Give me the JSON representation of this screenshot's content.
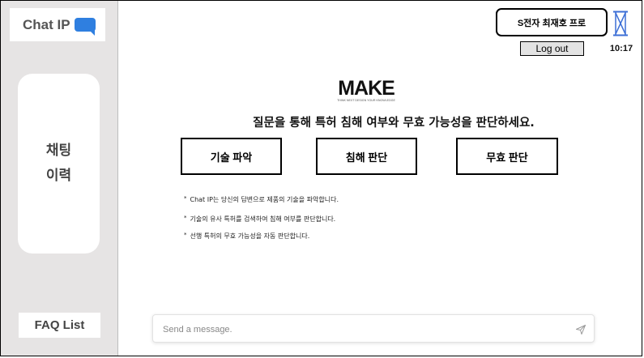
{
  "sidebar": {
    "logo_text": "Chat IP",
    "history_label": "채팅\n이력",
    "faq_label": "FAQ List"
  },
  "header": {
    "user_label": "S전자 최재호 프로",
    "logout_label": "Log out",
    "clock": "10:17"
  },
  "main": {
    "brand_text": "MAKE",
    "brand_subtext": "THINK NEXT DESIGN YOUR KNOWLEDGE",
    "tagline": "질문을 통해 특허 침해 여부와 무효 가능성을 판단하세요.",
    "actions": [
      {
        "label": "기술 파악"
      },
      {
        "label": "침해 판단"
      },
      {
        "label": "무효 판단"
      }
    ],
    "info_bullet": "*",
    "info": [
      "Chat IP는 당신의 답변으로 제품의 기술을 파악합니다.",
      "기술의 유사 특허를 검색하여 침해 여부를 판단합니다.",
      "선행 특허의 무효 가능성을 자동 판단합니다."
    ]
  },
  "chat": {
    "placeholder": "Send a message."
  },
  "colors": {
    "sidebar_bg": "#e6e4e4",
    "chat_icon": "#2f7fe0",
    "hourglass": "#3c6fd6",
    "logout_bg": "#e3e3e3"
  },
  "icons": [
    "chat-bubble-icon",
    "hourglass-icon",
    "send-icon"
  ]
}
